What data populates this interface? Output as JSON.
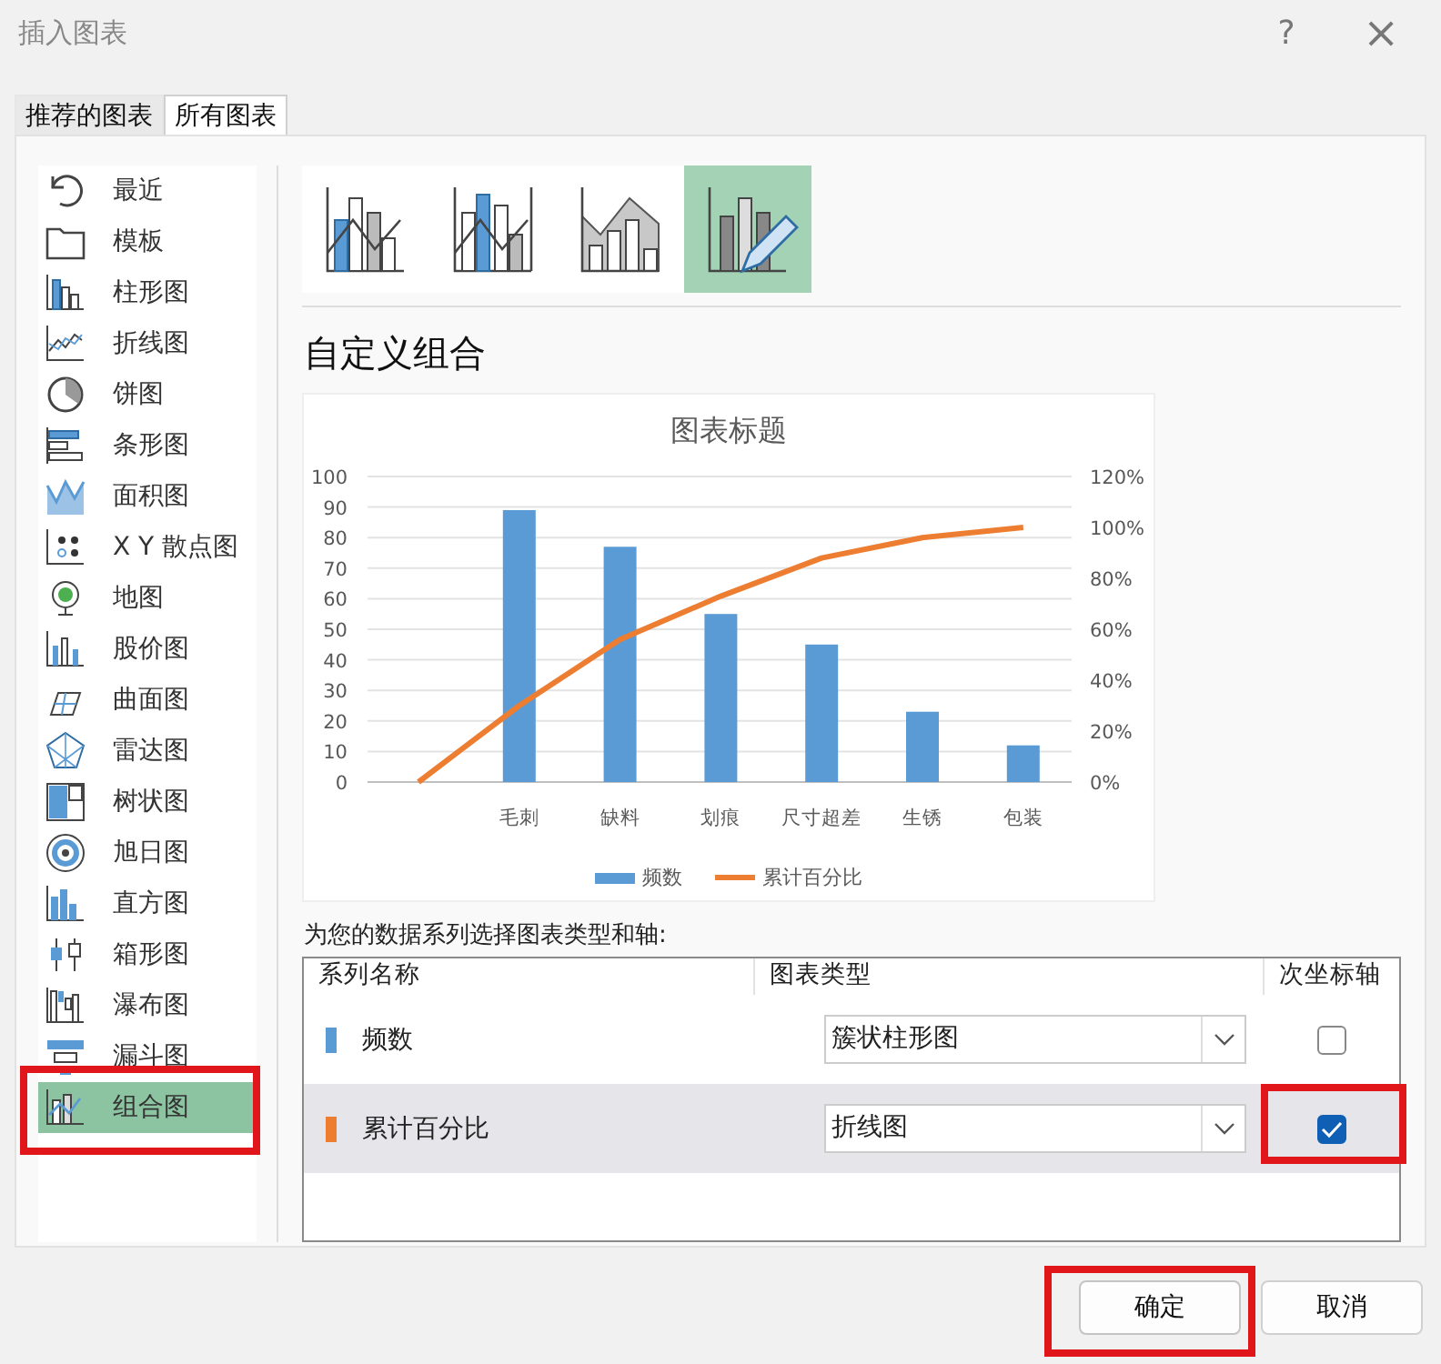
{
  "window": {
    "title": "插入图表",
    "help": "?",
    "close": "×"
  },
  "tabs": [
    {
      "label": "推荐的图表",
      "selected": false
    },
    {
      "label": "所有图表",
      "selected": true
    }
  ],
  "sidebar": {
    "items": [
      {
        "label": "最近",
        "selected": false,
        "highlighted": false
      },
      {
        "label": "模板",
        "selected": false,
        "highlighted": false
      },
      {
        "label": "柱形图",
        "selected": false,
        "highlighted": false
      },
      {
        "label": "折线图",
        "selected": false,
        "highlighted": false
      },
      {
        "label": "饼图",
        "selected": false,
        "highlighted": false
      },
      {
        "label": "条形图",
        "selected": false,
        "highlighted": false
      },
      {
        "label": "面积图",
        "selected": false,
        "highlighted": false
      },
      {
        "label": "X Y 散点图",
        "selected": false,
        "highlighted": false
      },
      {
        "label": "地图",
        "selected": false,
        "highlighted": false
      },
      {
        "label": "股价图",
        "selected": false,
        "highlighted": false
      },
      {
        "label": "曲面图",
        "selected": false,
        "highlighted": false
      },
      {
        "label": "雷达图",
        "selected": false,
        "highlighted": false
      },
      {
        "label": "树状图",
        "selected": false,
        "highlighted": false
      },
      {
        "label": "旭日图",
        "selected": false,
        "highlighted": false
      },
      {
        "label": "直方图",
        "selected": false,
        "highlighted": false
      },
      {
        "label": "箱形图",
        "selected": false,
        "highlighted": false
      },
      {
        "label": "瀑布图",
        "selected": false,
        "highlighted": false
      },
      {
        "label": "漏斗图",
        "selected": false,
        "highlighted": false
      },
      {
        "label": "组合图",
        "selected": true,
        "highlighted": true
      }
    ]
  },
  "subtypes": [
    {
      "selected": false
    },
    {
      "selected": false
    },
    {
      "selected": false
    },
    {
      "selected": true
    }
  ],
  "heading": "自定义组合",
  "preview": {
    "chart_data": {
      "type": "bar",
      "title": "图表标题",
      "categories": [
        null,
        "毛刺",
        "缺料",
        "划痕",
        "尺寸超差",
        "生锈",
        "包装"
      ],
      "series": [
        {
          "name": "频数",
          "color": "#5b9bd5",
          "values": [
            null,
            89,
            77,
            55,
            45,
            23,
            12
          ]
        },
        {
          "name": "累计百分比",
          "type": "line",
          "axis": "y2",
          "color": "#ed7d31",
          "values": [
            0,
            30,
            56,
            73,
            88,
            96,
            100
          ]
        }
      ],
      "grid": true,
      "legend": "bottom",
      "ylim": [
        0,
        100
      ],
      "yticks": [
        0,
        10,
        20,
        30,
        40,
        50,
        60,
        70,
        80,
        90,
        100
      ],
      "y2lim": [
        0,
        120
      ],
      "y2ticks": [
        {
          "value": 0,
          "label": "0%"
        },
        {
          "value": 20,
          "label": "20%"
        },
        {
          "value": 40,
          "label": "40%"
        },
        {
          "value": 60,
          "label": "60%"
        },
        {
          "value": 80,
          "label": "80%"
        },
        {
          "value": 100,
          "label": "100%"
        },
        {
          "value": 120,
          "label": "120%"
        }
      ]
    }
  },
  "series_prompt": "为您的数据系列选择图表类型和轴:",
  "series_table": {
    "columns": [
      "系列名称",
      "图表类型",
      "次坐标轴"
    ],
    "rows": [
      {
        "name": "频数",
        "color": "#5b9bd5",
        "chart_type": "簇状柱形图",
        "secondary_axis": false,
        "selected": false,
        "highlighted": false
      },
      {
        "name": "累计百分比",
        "color": "#ed7d31",
        "chart_type": "折线图",
        "secondary_axis": true,
        "selected": true,
        "highlighted": true
      }
    ]
  },
  "buttons": [
    {
      "label": "确定",
      "highlighted": true
    },
    {
      "label": "取消",
      "highlighted": false
    }
  ]
}
